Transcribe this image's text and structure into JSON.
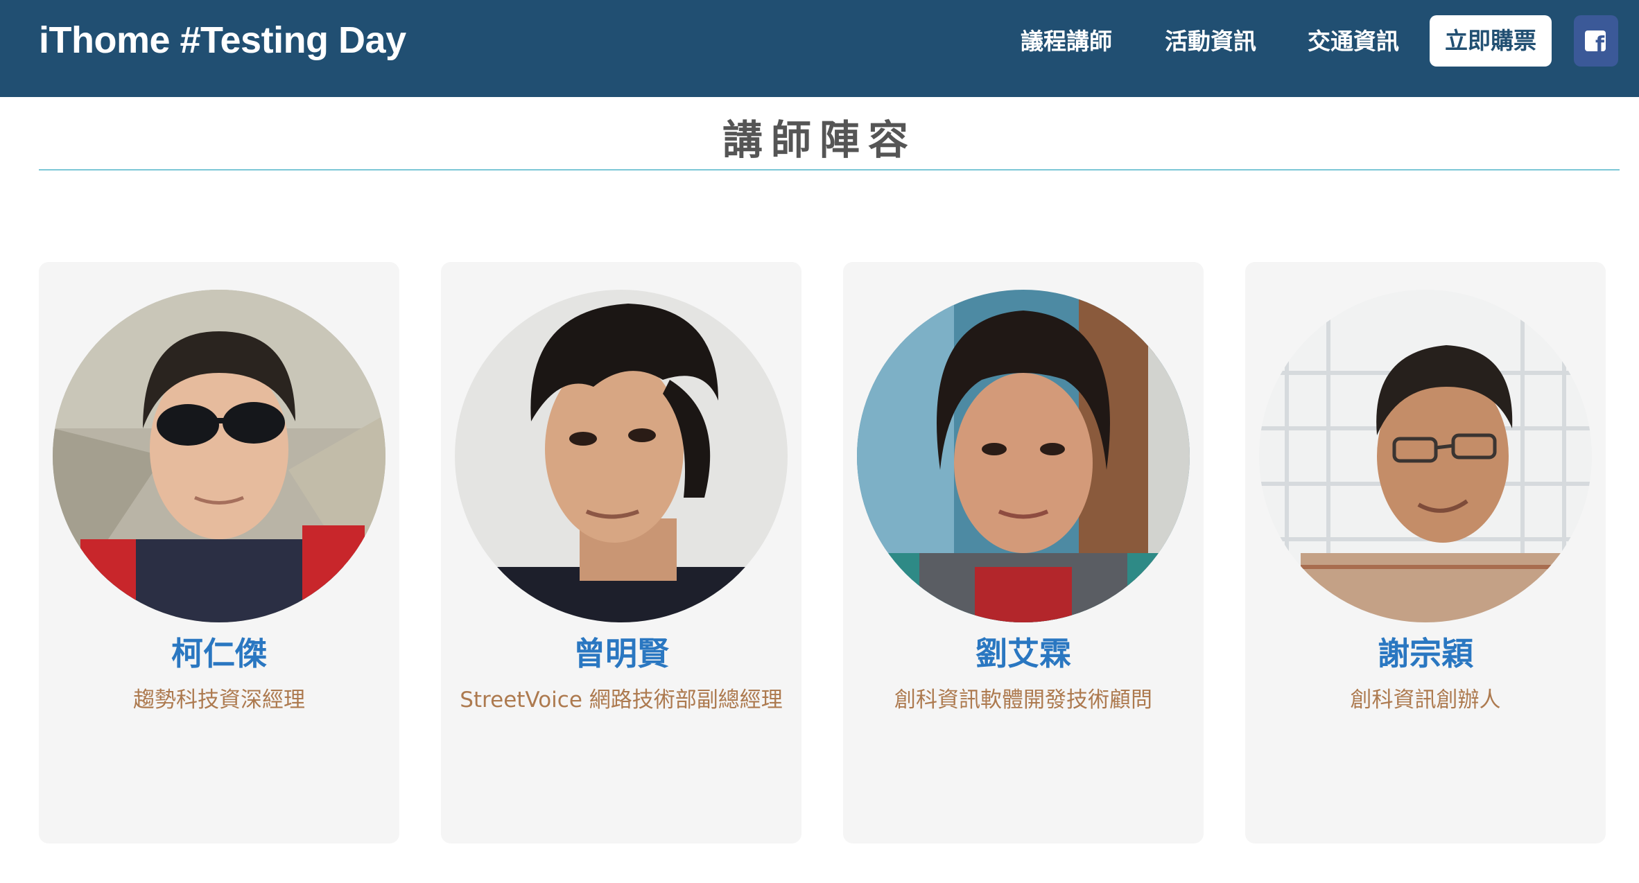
{
  "brand": "iThome #Testing Day",
  "nav": {
    "links": [
      "議程講師",
      "活動資訊",
      "交通資訊"
    ],
    "buy_label": "立即購票",
    "facebook_icon": "facebook-icon"
  },
  "section": {
    "title": "講師陣容"
  },
  "speakers": [
    {
      "name": "柯仁傑",
      "title": "趨勢科技資深經理",
      "photo": "speaker-photo"
    },
    {
      "name": "曾明賢",
      "title": "StreetVoice 網路技術部副總經理",
      "photo": "speaker-photo"
    },
    {
      "name": "劉艾霖",
      "title": "創科資訊軟體開發技術顧問",
      "photo": "speaker-photo"
    },
    {
      "name": "謝宗穎",
      "title": "創科資訊創辦人",
      "photo": "speaker-photo"
    }
  ],
  "colors": {
    "navbar": "#214f72",
    "name": "#2a77c1",
    "job_title": "#ad7a4f",
    "rule": "#7cc7d6",
    "facebook": "#3b5998"
  }
}
